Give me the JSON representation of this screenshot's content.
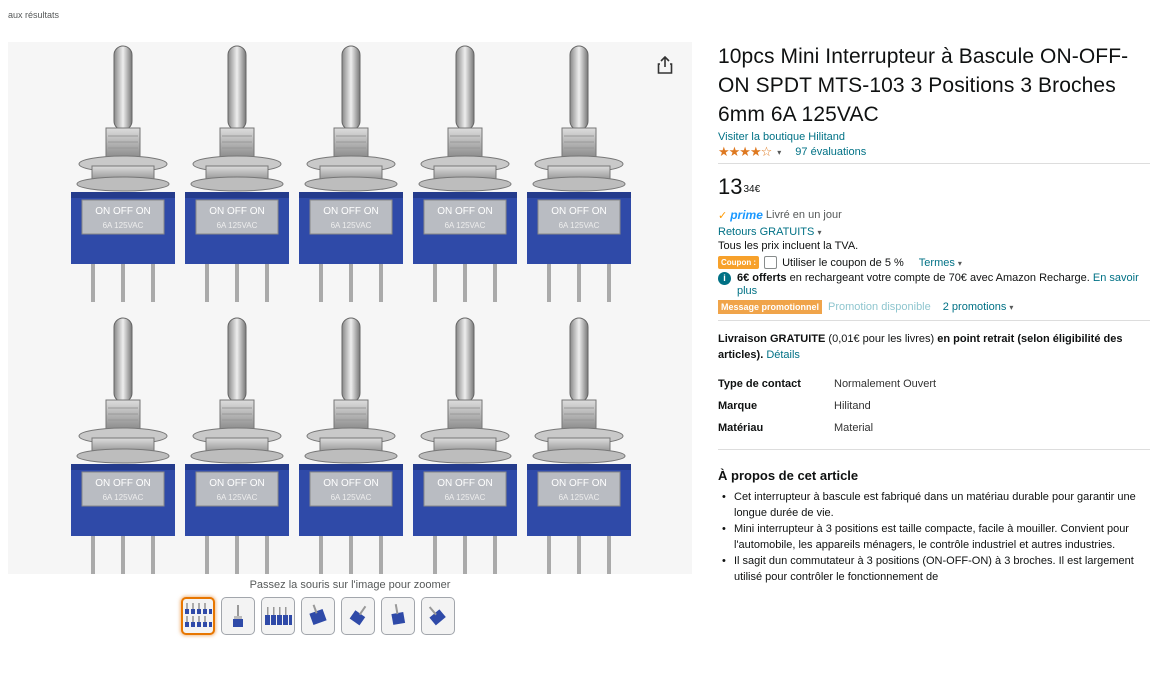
{
  "nav": {
    "back_label": "aux résultats"
  },
  "gallery": {
    "zoom_hint": "Passez la souris sur l'image pour zoomer",
    "thumbnail_count": 7
  },
  "product": {
    "title": "10pcs Mini Interrupteur à Bascule ON-OFF-ON SPDT MTS-103 3 Positions 3 Broches 6mm 6A 125VAC",
    "store_link": "Visiter la boutique Hilitand",
    "rating": 4.5,
    "stars": "★★★★☆",
    "reviews": "97 évaluations",
    "price_whole": "13",
    "price_fraction": "34€",
    "switch_label": "ON OFF ON"
  },
  "offers": {
    "prime_label": "prime",
    "prime_delivery": "Livré en un jour",
    "returns": "Retours GRATUITS",
    "tva": "Tous les prix incluent la TVA.",
    "coupon_badge": "Coupon :",
    "coupon_text": "Utiliser le coupon de 5 %",
    "terms": "Termes",
    "recharge_bold": "6€ offerts",
    "recharge_text": " en rechargeant votre compte de 70€ avec Amazon Recharge. ",
    "recharge_link": "En savoir plus",
    "promo_badge": "Message promotionnel",
    "promo_available": "Promotion disponible",
    "promotions_link": "2 promotions"
  },
  "delivery": {
    "bold1": "Livraison GRATUITE",
    "text1": " (0,01€ pour les livres) ",
    "bold2": "en point retrait (selon éligibilité des articles).",
    "link": "Détails"
  },
  "specs": [
    {
      "key": "Type de contact",
      "value": "Normalement Ouvert"
    },
    {
      "key": "Marque",
      "value": "Hilitand"
    },
    {
      "key": "Matériau",
      "value": "Material"
    }
  ],
  "about": {
    "title": "À propos de cet article",
    "bullets": [
      "Cet interrupteur à bascule est fabriqué dans un matériau durable pour garantir une longue durée de vie.",
      "Mini interrupteur à 3 positions est taille compacte, facile à mouiller. Convient pour l'automobile, les appareils ménagers, le contrôle industriel et autres industries.",
      "Il sagit dun commutateur à 3 positions (ON-OFF-ON) à 3 broches. Il est largement utilisé pour contrôler le fonctionnement de"
    ]
  },
  "colors": {
    "link": "#007185",
    "star": "#de7921",
    "switch_body": "#2f4aa8",
    "coupon": "#f7a12b"
  }
}
